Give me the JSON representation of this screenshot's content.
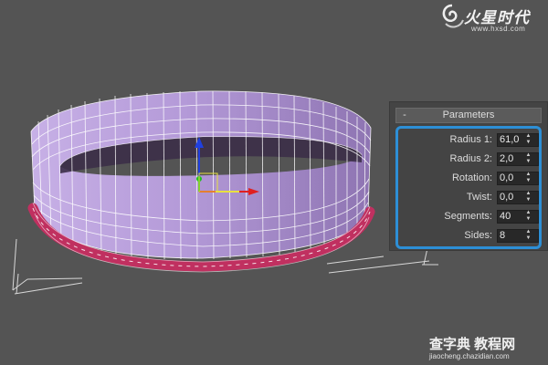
{
  "logo": {
    "title": "火星时代",
    "url": "www.hxsd.com"
  },
  "rollout": {
    "toggle": "-",
    "title": "Parameters"
  },
  "params": [
    {
      "label": "Radius 1:",
      "value": "61,0"
    },
    {
      "label": "Radius 2:",
      "value": "2,0"
    },
    {
      "label": "Rotation:",
      "value": "0,0"
    },
    {
      "label": "Twist:",
      "value": "0,0"
    },
    {
      "label": "Segments:",
      "value": "40"
    },
    {
      "label": "Sides:",
      "value": "8"
    }
  ],
  "spinner": {
    "up": "▲",
    "down": "▼"
  },
  "watermark": {
    "main": "查字典 教程网",
    "sub": "jiaocheng.chazidian.com"
  },
  "colors": {
    "viewport_bg": "#545454",
    "panel_bg": "#444444",
    "highlight": "#2d8fd6",
    "mesh_fill": "#b9a0d8",
    "mesh_line": "#ffffff",
    "torus": "#c03060",
    "gizmo_x": "#e02020",
    "gizmo_y": "#20c020",
    "gizmo_z": "#2040e0"
  }
}
